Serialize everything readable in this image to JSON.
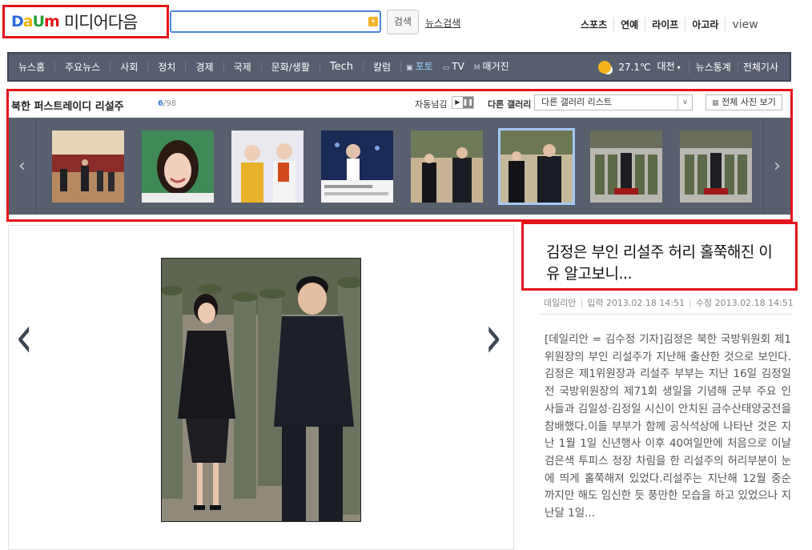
{
  "header": {
    "logo_letters": [
      "D",
      "a",
      "U",
      "m"
    ],
    "logo_colors": [
      "#2e6bd9",
      "#f2b100",
      "#25a339",
      "#e3141b"
    ],
    "site_title": "미디어다음",
    "search_value": "",
    "search_button": "검색",
    "news_search": "뉴스검색",
    "top_links": [
      "스포츠",
      "연예",
      "라이프",
      "아고라",
      "view"
    ]
  },
  "nav": {
    "items": [
      "뉴스홈",
      "주요뉴스",
      "사회",
      "정치",
      "경제",
      "국제",
      "문화/생활",
      "Tech",
      "칼럼"
    ],
    "media": [
      {
        "icon": "camera-icon",
        "glyph": "▣",
        "label": "포토",
        "active": true
      },
      {
        "icon": "tv-icon",
        "glyph": "▭",
        "label": "TV",
        "active": false
      },
      {
        "icon": "magazine-icon",
        "glyph": "M",
        "label": "매거진",
        "active": false
      }
    ],
    "weather": {
      "icon": "sun-cloud-icon",
      "temp": "27.1℃",
      "city": "대전"
    },
    "right_links": [
      "뉴스통계",
      "전체기사"
    ]
  },
  "gallery": {
    "title": "북한 퍼스트레이디 리설주",
    "current": "6",
    "total": "/98",
    "autoplay_label": "자동넘김",
    "other_label": "다른 갤러리",
    "select_value": "다른 갤러리 리스트",
    "all_photos": "전체 사진 보기",
    "selected_index": 5,
    "thumbs": [
      "thumb-1",
      "thumb-2",
      "thumb-3",
      "thumb-4",
      "thumb-5",
      "thumb-6",
      "thumb-7",
      "thumb-8"
    ]
  },
  "article": {
    "headline": "김정은 부인 리설주 허리 홀쭉해진 이유 알고보니...",
    "source": "데일리안",
    "input_time": "입력 2013.02.18 14:51",
    "edit_time": "수정 2013.02.18 14:51",
    "body": "[데일리안 = 김수정 기자]김정은 북한 국방위원회 제1위원장의 부인 리설주가 지난해 출산한 것으로 보인다.김정은 제1위원장과 리설주 부부는 지난 16일 김정일 전 국방위원장의 제71회 생일을 기념해 군부 주요 인사들과 김일성·김정일 시신이 안치된 금수산태양궁전을 참배했다.이들 부부가 함께 공식석상에 나타난 것은 지난 1월 1일 신년행사 이후 40여일만에 처음으로 이날 검은색 투피스 정장 차림을 한 리설주의 허리부분이 눈에 띄게 홀쭉해져 있었다.리설주는 지난해 12월 중순까지만 해도 임신한 듯 풍만한 모습을 하고 있었으나 지난달 1일..."
  },
  "colors": {
    "highlight": "#e3141b",
    "nav_bg": "#575f6e",
    "search_border": "#4b86d8"
  }
}
